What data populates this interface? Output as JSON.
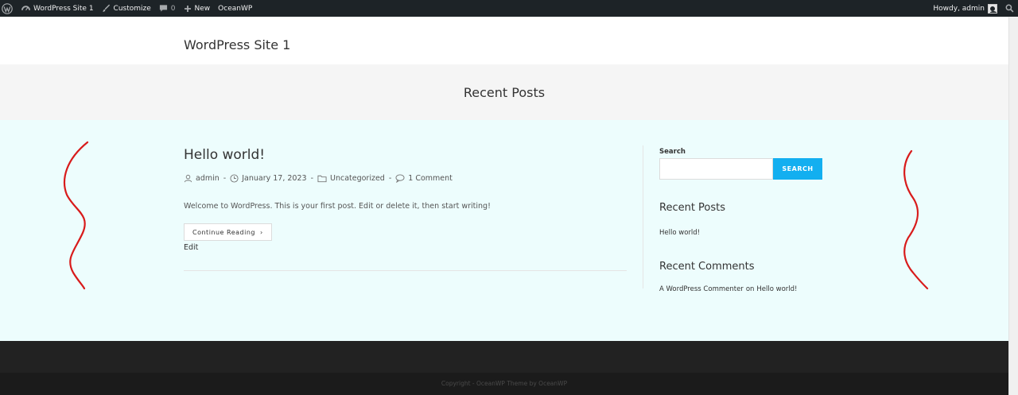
{
  "adminbar": {
    "site_name": "WordPress Site 1",
    "customize": "Customize",
    "comments_count": "0",
    "new_label": "New",
    "theme_label": "OceanWP",
    "howdy": "Howdy, admin"
  },
  "header": {
    "site_title": "WordPress Site 1"
  },
  "page": {
    "title": "Recent Posts"
  },
  "post": {
    "title": "Hello world!",
    "author": "admin",
    "date": "January 17, 2023",
    "category": "Uncategorized",
    "comments": "1 Comment",
    "meta_separator": "-",
    "excerpt": "Welcome to WordPress. This is your first post. Edit or delete it, then start writing!",
    "continue_label": "Continue Reading",
    "edit_label": "Edit"
  },
  "sidebar": {
    "search_label": "Search",
    "search_value": "",
    "search_button": "SEARCH",
    "recent_posts_title": "Recent Posts",
    "recent_posts": [
      "Hello world!"
    ],
    "recent_comments_title": "Recent Comments",
    "recent_comment": {
      "author": "A WordPress Commenter",
      "on": "on",
      "post": "Hello world!"
    }
  },
  "footer": {
    "copyright": "Copyright - OceanWP Theme by OceanWP"
  },
  "colors": {
    "adminbar_bg": "#1d2327",
    "accent": "#13aff0",
    "content_bg": "#edfdfd",
    "annotation": "#d81b1b"
  },
  "icons": {
    "wordpress": "wordpress-logo-icon",
    "dashboard": "dashboard-icon",
    "customize": "paintbrush-icon",
    "comments": "comment-bubble-icon",
    "new": "plus-icon",
    "search": "search-icon",
    "author": "user-icon",
    "date": "clock-icon",
    "category": "folder-icon",
    "comment": "speech-bubble-icon"
  }
}
